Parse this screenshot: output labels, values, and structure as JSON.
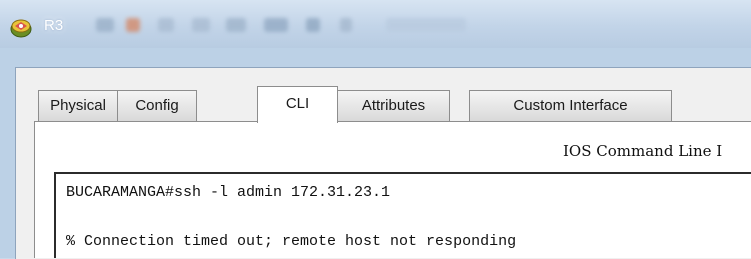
{
  "window": {
    "title": "R3",
    "app_icon": "packet-tracer-router-icon"
  },
  "tabs": [
    {
      "label": "Physical",
      "active": false
    },
    {
      "label": "Config",
      "active": false
    },
    {
      "label": "CLI",
      "active": true
    },
    {
      "label": "Attributes",
      "active": false
    },
    {
      "label": "Custom Interface",
      "active": false
    }
  ],
  "cli": {
    "heading": "IOS Command Line I",
    "lines": [
      "BUCARAMANGA#ssh -l admin 172.31.23.1",
      "",
      "% Connection timed out; remote host not responding"
    ]
  },
  "colors": {
    "titlebar": "#c2d4e8",
    "panel": "#f0f0f0",
    "terminal_border": "#2b2b2b"
  }
}
